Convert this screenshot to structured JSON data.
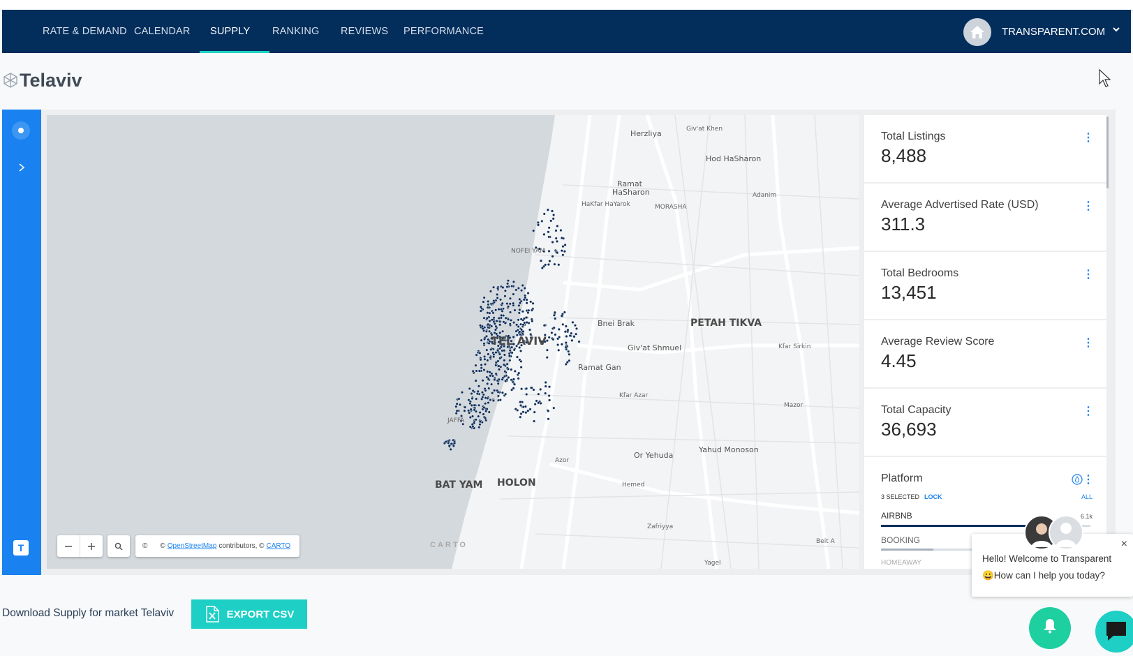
{
  "nav": {
    "items": [
      {
        "label": "RATE & DEMAND"
      },
      {
        "label": "CALENDAR"
      },
      {
        "label": "SUPPLY"
      },
      {
        "label": "RANKING"
      },
      {
        "label": "REVIEWS"
      },
      {
        "label": "PERFORMANCE"
      }
    ],
    "active": "SUPPLY",
    "user_name": "TRANSPARENT.COM"
  },
  "page": {
    "title": "Telaviv"
  },
  "map": {
    "labels": {
      "herzliya": "Herzliya",
      "givat_khen": "Giv'at Khen",
      "hod_hasharon": "Hod HaSharon",
      "ramat_hasharon": "Ramat HaSharon",
      "hakfar_hayarok": "HaKfar HaYarok",
      "morasha": "MORASHA",
      "adanim": "Adanim",
      "nofei_yam": "NOFEI YAM",
      "bnei_brak": "Bnei Brak",
      "petah_tikva": "PETAH TIKVA",
      "tel_aviv": "TEL AVIV",
      "givat_shmuel": "Giv'at Shmuel",
      "kfar_sirkin": "Kfar Sirkin",
      "ramat_gan": "Ramat Gan",
      "kfar_azar": "Kfar Azar",
      "mazor": "Mazor",
      "jaffa": "JAFFA",
      "or_yehuda": "Or Yehuda",
      "yahud_monoson": "Yahud Monoson",
      "azor": "Azor",
      "bat_yam": "BAT YAM",
      "holon": "HOLON",
      "hemed": "Hemed",
      "zafriyya": "Zafriyya",
      "beit_arif": "Beit A",
      "yagel": "Yagel"
    },
    "attribution": {
      "copyright": "©",
      "prefix": "©",
      "osm_link": "OpenStreetMap",
      "middle": "contributors, ©",
      "carto_link": "CARTO"
    },
    "carto_logo": "CARTO"
  },
  "stats": [
    {
      "label": "Total Listings",
      "value": "8,488"
    },
    {
      "label": "Average Advertised Rate (USD)",
      "value": "311.3"
    },
    {
      "label": "Total Bedrooms",
      "value": "13,451"
    },
    {
      "label": "Average Review Score",
      "value": "4.45"
    },
    {
      "label": "Total Capacity",
      "value": "36,693"
    }
  ],
  "platform": {
    "title": "Platform",
    "selected": "3 SELECTED",
    "lock": "LOCK",
    "all": "ALL",
    "rows": [
      {
        "name": "AIRBNB",
        "value": "6.1k",
        "fraction": 0.72
      },
      {
        "name": "BOOKING",
        "value": "",
        "fraction": 0.25
      },
      {
        "name": "HOMEAWAY",
        "value": "",
        "fraction": 0.05
      }
    ]
  },
  "footer": {
    "download_text": "Download Supply for market Telaviv",
    "export_label": "EXPORT CSV"
  },
  "chat": {
    "greeting": "Hello! Welcome to Transparent",
    "question": "😀How can I help you today?",
    "close": "×"
  },
  "sidebar": {
    "logo_letter": "T"
  },
  "colors": {
    "nav_bg": "#032e5c",
    "accent": "#1ecfc6",
    "sidebar": "#1982f0",
    "dot": "#0d2d5a"
  }
}
